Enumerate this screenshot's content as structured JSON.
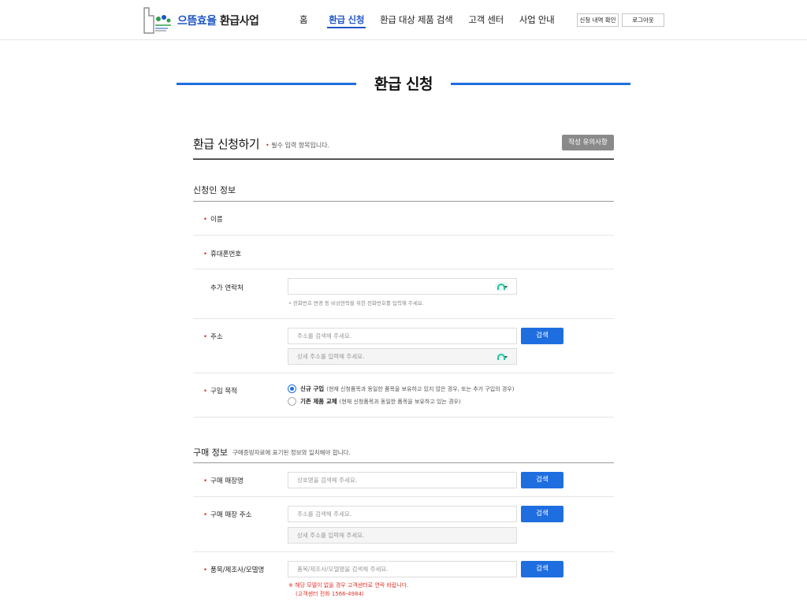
{
  "header": {
    "logo_main": "으뜸효율",
    "logo_sub": "환급사업",
    "nav": [
      "홈",
      "환급 신청",
      "환급 대상 제품 검색",
      "고객 센터",
      "사업 안내"
    ],
    "btn_history": "신청 내역 확인",
    "btn_logout": "로그아웃"
  },
  "page_title": "환급 신청",
  "form": {
    "title": "환급 신청하기",
    "note_dot": "•",
    "note": "필수 입력 항목입니다.",
    "guide_btn": "작성 유의사항"
  },
  "applicant": {
    "title": "신청인 정보",
    "name_label": "이름",
    "phone_label": "휴대폰번호",
    "extra_label": "추가 연락처",
    "extra_hint": "• 전화번호 변경 등 비상연락을 위한 전화번호를 입력해 주세요.",
    "address_label": "주소",
    "address_placeholder": "주소를 검색해 주세요.",
    "address_detail_placeholder": "상세 주소를 입력해 주세요.",
    "search_btn": "검색",
    "purpose_label": "구입 목적",
    "purpose_options": [
      {
        "label": "신규 구입",
        "desc": "(현재 신청품목과 동일한 품목을 보유하고 있지 않은 경우, 또는 추가 구입의 경우)",
        "selected": true
      },
      {
        "label": "기존 제품 교체",
        "desc": "(현재 신청품목과 동일한 품목을 보유하고 있는 경우)",
        "selected": false
      }
    ]
  },
  "purchase": {
    "title": "구매 정보",
    "subtitle": "구매증빙자료에 표기된 정보와 일치해야 합니다.",
    "store_label": "구매 매장명",
    "store_placeholder": "상호명을 검색해 주세요.",
    "store_addr_label": "구매 매장 주소",
    "store_addr_placeholder": "주소를 검색해 주세요.",
    "store_addr_detail_placeholder": "상세 주소를 입력해 주세요.",
    "model_label": "품목/제조사/모델명",
    "model_placeholder": "품목/제조사/모델명을 검색해 주세요.",
    "warn_1": "※ 해당 모델이 없을 경우 고객센터로 연락 바랍니다.",
    "warn_2": "(고객센터 전화 1566-4984)",
    "search_btn": "검색"
  },
  "colors": {
    "accent": "#1f6ee0",
    "required": "#e0322a"
  }
}
